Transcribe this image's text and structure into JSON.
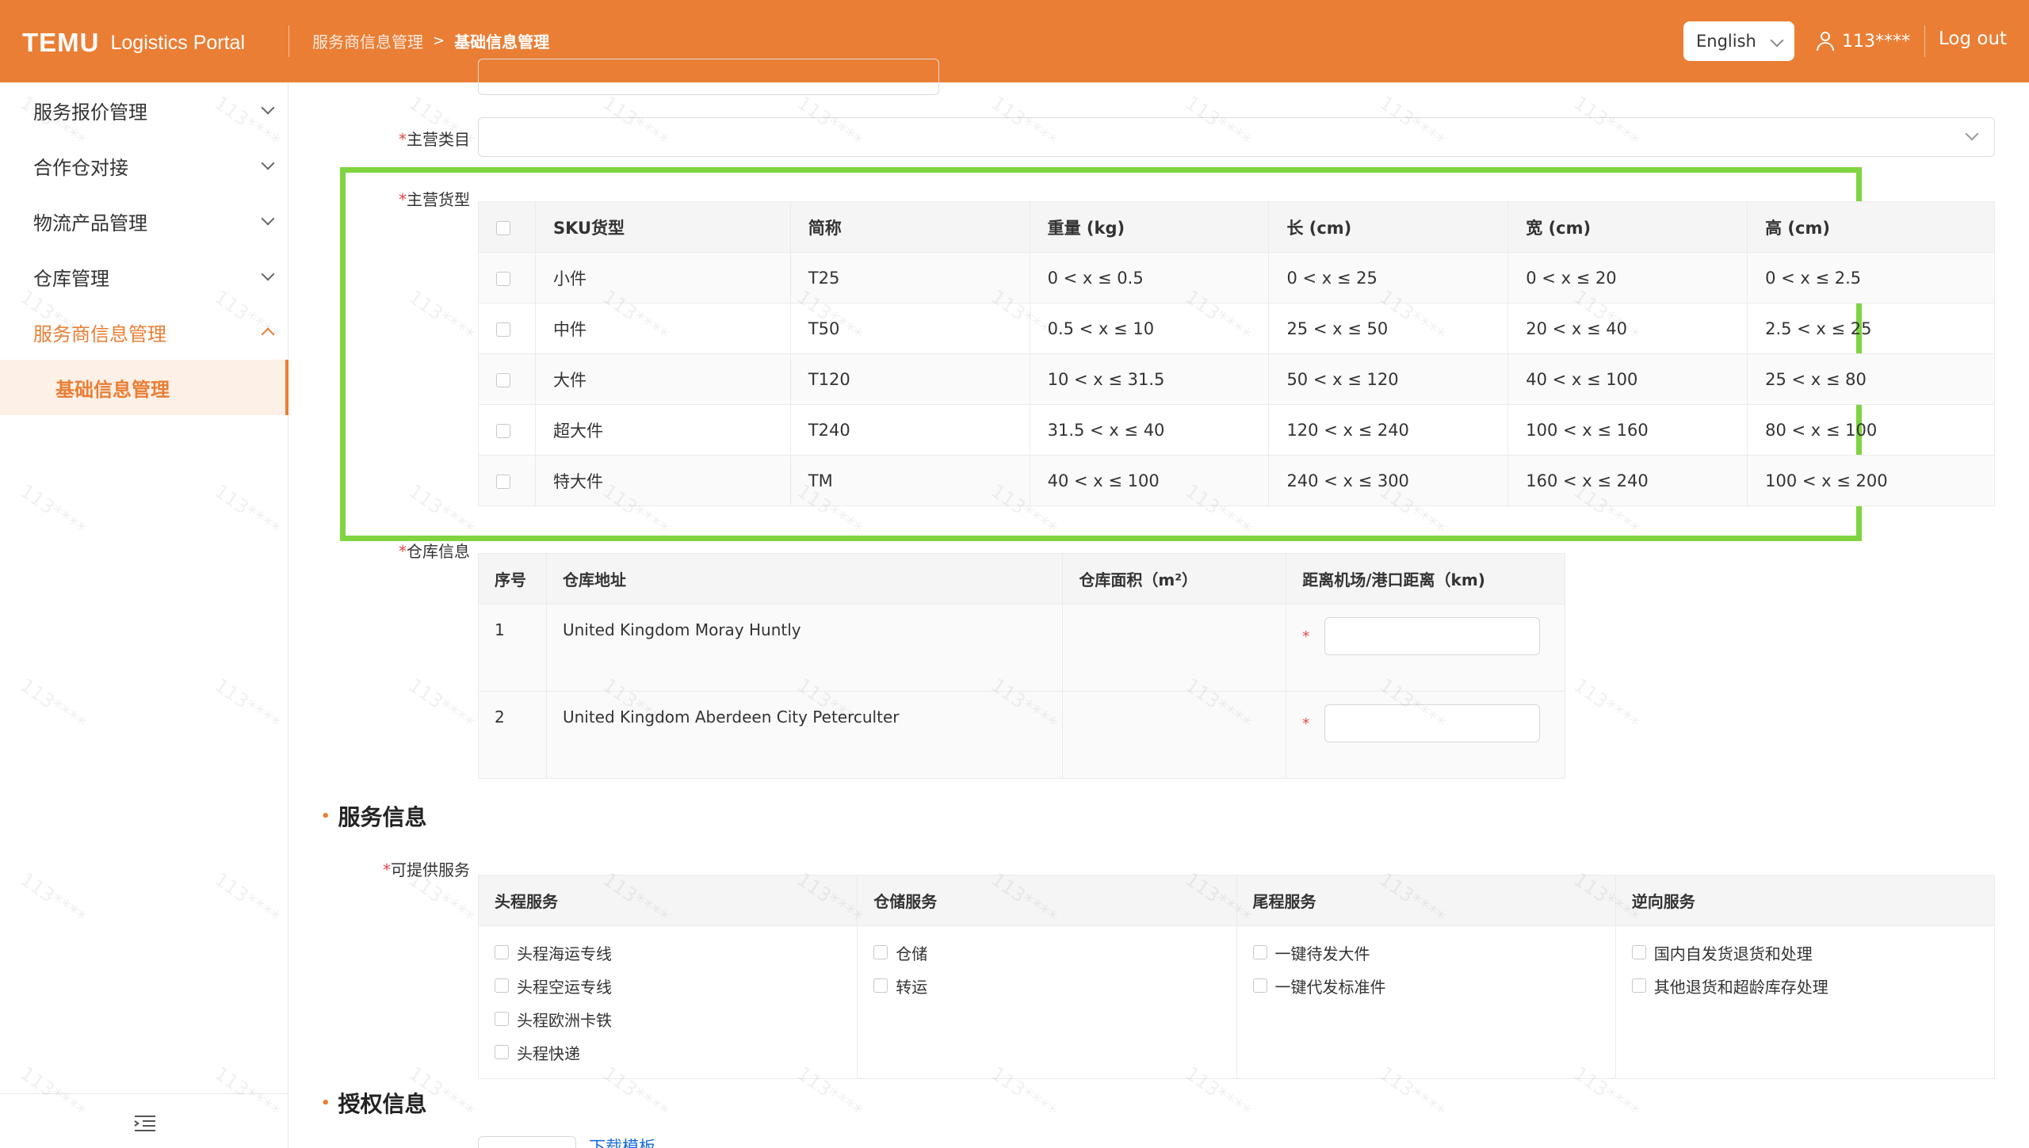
{
  "header": {
    "brand": "TEMU",
    "portal": "Logistics Portal",
    "breadcrumb": [
      "服务商信息管理",
      "基础信息管理"
    ],
    "breadcrumb_sep": ">",
    "language": "English",
    "user": "113****",
    "logout": "Log out",
    "accent_color": "#ea7e34"
  },
  "sidebar": {
    "items": [
      {
        "label": "服务报价管理"
      },
      {
        "label": "合作仓对接"
      },
      {
        "label": "物流产品管理"
      },
      {
        "label": "仓库管理"
      },
      {
        "label": "服务商信息管理",
        "active": true
      }
    ],
    "sub_item": "基础信息管理"
  },
  "form": {
    "category_label": "主营类目",
    "cargo_label": "主营货型",
    "warehouse_label": "仓库信息",
    "required_mark": "*"
  },
  "sku_table": {
    "headers": [
      "SKU货型",
      "简称",
      "重量 (kg)",
      "长 (cm)",
      "宽 (cm)",
      "高 (cm)"
    ],
    "rows": [
      [
        "小件",
        "T25",
        "0 < x ≤ 0.5",
        "0 < x ≤ 25",
        "0 < x ≤ 20",
        "0 < x ≤ 2.5"
      ],
      [
        "中件",
        "T50",
        "0.5 < x ≤ 10",
        "25 < x ≤ 50",
        "20 < x ≤ 40",
        "2.5 < x ≤ 25"
      ],
      [
        "大件",
        "T120",
        "10 < x ≤ 31.5",
        "50 < x ≤ 120",
        "40 < x ≤ 100",
        "25 < x ≤ 80"
      ],
      [
        "超大件",
        "T240",
        "31.5 < x ≤ 40",
        "120 < x ≤ 240",
        "100 < x ≤ 160",
        "80 < x ≤ 100"
      ],
      [
        "特大件",
        "TM",
        "40 < x ≤ 100",
        "240 < x ≤ 300",
        "160 < x ≤ 240",
        "100 < x ≤ 200"
      ]
    ]
  },
  "warehouse_table": {
    "headers": [
      "序号",
      "仓库地址",
      "仓库面积（m²）",
      "距离机场/港口距离（km)"
    ],
    "rows": [
      [
        "1",
        "United Kingdom Moray Huntly",
        ""
      ],
      [
        "2",
        "United Kingdom Aberdeen City Peterculter",
        ""
      ]
    ]
  },
  "service_section": {
    "title": "服务信息",
    "label": "可提供服务",
    "columns": [
      {
        "header": "头程服务",
        "options": [
          "头程海运专线",
          "头程空运专线",
          "头程欧洲卡铁",
          "头程快递"
        ]
      },
      {
        "header": "仓储服务",
        "options": [
          "仓储",
          "转运"
        ]
      },
      {
        "header": "尾程服务",
        "options": [
          "一键待发大件",
          "一键代发标准件"
        ]
      },
      {
        "header": "逆向服务",
        "options": [
          "国内自发货退货和处理",
          "其他退货和超龄库存处理"
        ]
      }
    ]
  },
  "auth_section": {
    "title": "授权信息",
    "download_link": "下载模板"
  },
  "watermark": "113****"
}
